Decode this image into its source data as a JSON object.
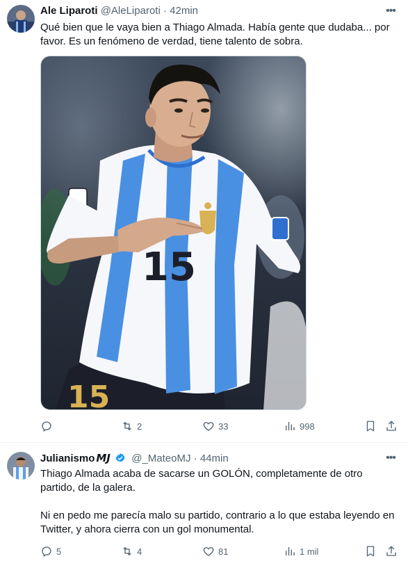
{
  "tweets": [
    {
      "display_name": "Ale Liparoti",
      "handle": "@AleLiparoti",
      "separator": "·",
      "time": "42min",
      "text": "Qué bien que le vaya bien a Thiago Almada. Había gente que dudaba... por favor. Es un fenómeno de verdad, tiene talento de sobra.",
      "media": {
        "jersey_number": "15",
        "kit_colors": {
          "stripe": "#4a90e2",
          "white": "#f6f7fb",
          "shorts": "#1c1f2a",
          "gold": "#d8b254"
        }
      },
      "actions": {
        "replies": "",
        "reposts": "2",
        "likes": "33",
        "views": "998"
      }
    },
    {
      "display_name": "Julianismo",
      "badge": "𝙈𝙅",
      "handle": "@_MateoMJ",
      "separator": "·",
      "time": "44min",
      "text": "Thiago Almada acaba de sacarse un GOLÓN, completamente de otro partido, de la galera.\n\nNi en pedo me parecía malo su partido, contrario a lo que estaba leyendo en Twitter, y ahora cierra con un gol monumental.",
      "actions": {
        "replies": "5",
        "reposts": "4",
        "likes": "81",
        "views": "1 mil"
      }
    }
  ],
  "colors": {
    "muted": "#536471",
    "verified": "#1d9bf0",
    "border": "#eff3f4"
  }
}
